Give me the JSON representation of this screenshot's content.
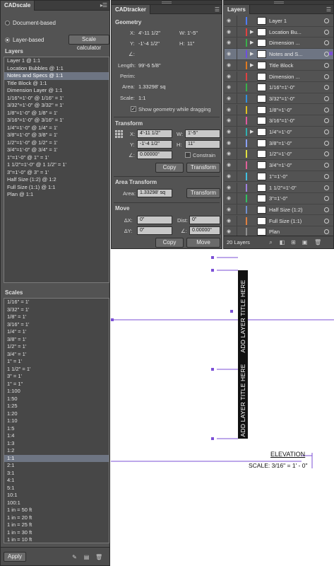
{
  "cadscale": {
    "tab": "CADscale",
    "mode_document": "Document-based",
    "mode_layer": "Layer-based",
    "scale_calculator": "Scale calculator",
    "layers_heading": "Layers",
    "layers": [
      "Layer 1 @ 1:1",
      "Location Bubbles @ 1:1",
      "Notes and Specs @ 1:1",
      "Title Block @ 1:1",
      "Dimension Layer @ 1:1",
      "1/16\"=1'-0\" @ 1/16\" = 1'",
      "3/32\"=1'-0\" @ 3/32\" = 1'",
      "1/8\"=1'-0\" @ 1/8\" = 1'",
      "3/16\"=1'-0\" @ 3/16\" = 1'",
      "1/4\"=1'-0\" @ 1/4\" = 1'",
      "3/8\"=1'-0\" @ 3/8\" = 1'",
      "1/2\"=1'-0\" @ 1/2\" = 1'",
      "3/4\"=1'-0\" @ 3/4\" = 1'",
      "1\"=1'-0\" @ 1\" = 1'",
      "1 1/2\"=1'-0\" @ 1 1/2\" = 1'",
      "3\"=1'-0\" @ 3\" = 1'",
      "Half Size (1:2) @ 1:2",
      "Full Size (1:1) @ 1:1",
      "Plan @ 1:1"
    ],
    "selected_layer_index": 2,
    "scales_heading": "Scales",
    "scales": [
      "1/16\" = 1'",
      "3/32\" = 1'",
      "1/8\" = 1'",
      "3/16\" = 1'",
      "1/4\" = 1'",
      "3/8\" = 1'",
      "1/2\" = 1'",
      "3/4\" = 1'",
      "1\" = 1'",
      "1 1/2\" = 1'",
      "3\" = 1'",
      "1\" = 1\"",
      "1:100",
      "1:50",
      "1:25",
      "1:20",
      "1:10",
      "1:5",
      "1:4",
      "1:3",
      "1:2",
      "1:1",
      "2:1",
      "3:1",
      "4:1",
      "5:1",
      "10:1",
      "100:1",
      "1 in = 50 ft",
      "1 in = 20 ft",
      "1 in = 25 ft",
      "1 in = 30 ft",
      "1 in = 10 ft"
    ],
    "selected_scale_index": 21,
    "apply": "Apply",
    "icons": [
      "eyedropper-icon",
      "new-scale-icon",
      "trash-icon"
    ]
  },
  "tracker": {
    "tab": "CADtracker",
    "geometry_heading": "Geometry",
    "x_label": "X:",
    "x_value": "4'-11 1/2\"",
    "w_label": "W:",
    "w_value": "1'-5\"",
    "y_label": "Y:",
    "y_value": "-1'-4 1/2\"",
    "h_label": "H:",
    "h_value": "11\"",
    "angle_symbol": "∠:",
    "length_label": "Length:",
    "length_value": "99'-6 5/8\"",
    "perim_label": "Perim:",
    "area_label": "Area:",
    "area_value": "1.33298' sq",
    "scale_label": "Scale:",
    "scale_value": "1:1",
    "show_geometry": "Show geometry while dragging",
    "transform_heading": "Transform",
    "t_x": "4'-11 1/2\"",
    "t_w": "1'-5\"",
    "t_y": "-1'-4 1/2\"",
    "t_h": "11\"",
    "t_angle": "0.00000°",
    "constrain": "Constrain",
    "copy": "Copy",
    "transform": "Transform",
    "area_transform_heading": "Area Transform",
    "at_area_label": "Area:",
    "at_area": "1.33298' sq",
    "at_transform": "Transform",
    "move_heading": "Move",
    "dx_label": "∆X:",
    "dx": "0\"",
    "dist_label": "Dist:",
    "dist": "0\"",
    "dy_label": "∆Y:",
    "dy": "0\"",
    "m_angle_label": "∠:",
    "m_angle": "0.00000°",
    "move_copy": "Copy",
    "move": "Move"
  },
  "layers_panel": {
    "tab": "Layers",
    "count": "20 Layers",
    "rows": [
      {
        "name": "Layer 1",
        "color": "#4f7cff",
        "arrow": false
      },
      {
        "name": "Location Bu...",
        "color": "#e04040",
        "arrow": true
      },
      {
        "name": "Dimension ...",
        "color": "#3ab04a",
        "arrow": true
      },
      {
        "name": "Notes and S...",
        "color": "#6d4fe0",
        "arrow": true
      },
      {
        "name": "Title Block",
        "color": "#e07a20",
        "arrow": true
      },
      {
        "name": "Dimension ...",
        "color": "#e04040",
        "arrow": false
      },
      {
        "name": "1/16\"=1'-0\"",
        "color": "#3ab04a",
        "arrow": false
      },
      {
        "name": "3/32\"=1'-0\"",
        "color": "#3090e0",
        "arrow": false
      },
      {
        "name": "1/8\"=1'-0\"",
        "color": "#e0c020",
        "arrow": false
      },
      {
        "name": "3/16\"=1'-0\"",
        "color": "#e05aa0",
        "arrow": false
      },
      {
        "name": "1/4\"=1'-0\"",
        "color": "#30b0b0",
        "arrow": true
      },
      {
        "name": "3/8\"=1'-0\"",
        "color": "#8aa0ff",
        "arrow": false
      },
      {
        "name": "1/2\"=1'-0\"",
        "color": "#e0e040",
        "arrow": false
      },
      {
        "name": "3/4\"=1'-0\"",
        "color": "#e0609a",
        "arrow": false
      },
      {
        "name": "1\"=1'-0\"",
        "color": "#40c0e0",
        "arrow": false
      },
      {
        "name": "1 1/2\"=1'-0\"",
        "color": "#a080e0",
        "arrow": false
      },
      {
        "name": "3\"=1'-0\"",
        "color": "#30c060",
        "arrow": false
      },
      {
        "name": "Half Size (1:2)",
        "color": "#7090d0",
        "arrow": false
      },
      {
        "name": "Full Size (1:1)",
        "color": "#e08040",
        "arrow": false
      },
      {
        "name": "Plan",
        "color": "#909090",
        "arrow": false
      }
    ],
    "selected_index": 3
  },
  "canvas": {
    "title_block_1": "ADD LAYER TITLE HERE",
    "title_block_2": "ADD LAYER TITLE HERE",
    "elevation": "ELEVATION",
    "scale_note": "SCALE: 3/16\" = 1' - 0\"",
    "accent": "#7b4fd6"
  }
}
